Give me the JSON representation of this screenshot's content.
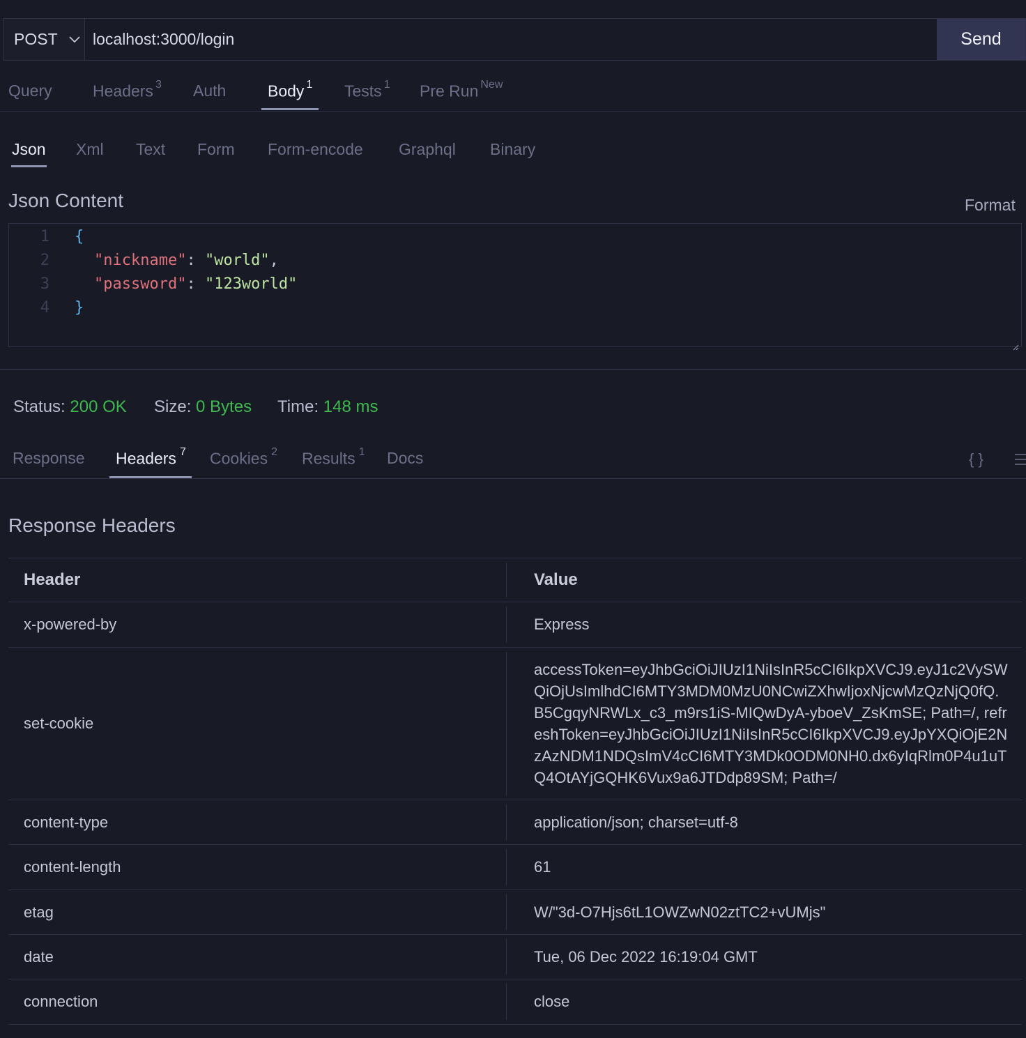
{
  "request": {
    "method": "POST",
    "url": "localhost:3000/login",
    "send_label": "Send"
  },
  "request_tabs": [
    {
      "label": "Query",
      "badge": ""
    },
    {
      "label": "Headers",
      "badge": "3"
    },
    {
      "label": "Auth",
      "badge": ""
    },
    {
      "label": "Body",
      "badge": "1"
    },
    {
      "label": "Tests",
      "badge": "1"
    },
    {
      "label": "Pre Run",
      "badge": "New"
    }
  ],
  "body_tabs": [
    "Json",
    "Xml",
    "Text",
    "Form",
    "Form-encode",
    "Graphql",
    "Binary"
  ],
  "json_section": {
    "title": "Json Content",
    "format_label": "Format",
    "line_numbers": [
      "1",
      "2",
      "3",
      "4"
    ],
    "open_brace": "{",
    "close_brace": "}",
    "lines": [
      {
        "key": "\"nickname\"",
        "colon": ": ",
        "value": "\"world\"",
        "trail": ","
      },
      {
        "key": "\"password\"",
        "colon": ": ",
        "value": "\"123world\"",
        "trail": ""
      }
    ]
  },
  "status_bar": {
    "status_label": "Status:",
    "status_value": "200 OK",
    "size_label": "Size:",
    "size_value": "0 Bytes",
    "time_label": "Time:",
    "time_value": "148 ms"
  },
  "response_tabs": [
    {
      "label": "Response",
      "badge": ""
    },
    {
      "label": "Headers",
      "badge": "7"
    },
    {
      "label": "Cookies",
      "badge": "2"
    },
    {
      "label": "Results",
      "badge": "1"
    },
    {
      "label": "Docs",
      "badge": ""
    }
  ],
  "response_icons": {
    "braces": "{ }",
    "menu": "menu-icon"
  },
  "response_headers": {
    "title": "Response Headers",
    "col_header": "Header",
    "col_value": "Value",
    "rows": [
      {
        "name": "x-powered-by",
        "value": "Express"
      },
      {
        "name": "set-cookie",
        "value": "accessToken=eyJhbGciOiJIUzI1NiIsInR5cCI6IkpXVCJ9.eyJ1c2VySWQiOjUsImlhdCI6MTY3MDM0MzU0NCwiZXhwIjoxNjcwMzQzNjQ0fQ.B5CgqyNRWLx_c3_m9rs1iS-MIQwDyA-yboeV_ZsKmSE; Path=/, refreshToken=eyJhbGciOiJIUzI1NiIsInR5cCI6IkpXVCJ9.eyJpYXQiOjE2NzAzNDM1NDQsImV4cCI6MTY3MDk0ODM0NH0.dx6yIqRlm0P4u1uTQ4OtAYjGQHK6Vux9a6JTDdp89SM; Path=/"
      },
      {
        "name": "content-type",
        "value": "application/json; charset=utf-8"
      },
      {
        "name": "content-length",
        "value": "61"
      },
      {
        "name": "etag",
        "value": "W/\"3d-O7Hjs6tL1OWZwN02ztTC2+vUMjs\""
      },
      {
        "name": "date",
        "value": "Tue, 06 Dec 2022 16:19:04 GMT"
      },
      {
        "name": "connection",
        "value": "close"
      }
    ]
  },
  "colors": {
    "background": "#181a25",
    "accent_green": "#3fb950",
    "send_button": "#313552",
    "json_key": "#e0707a",
    "json_string": "#bfe3a2"
  }
}
